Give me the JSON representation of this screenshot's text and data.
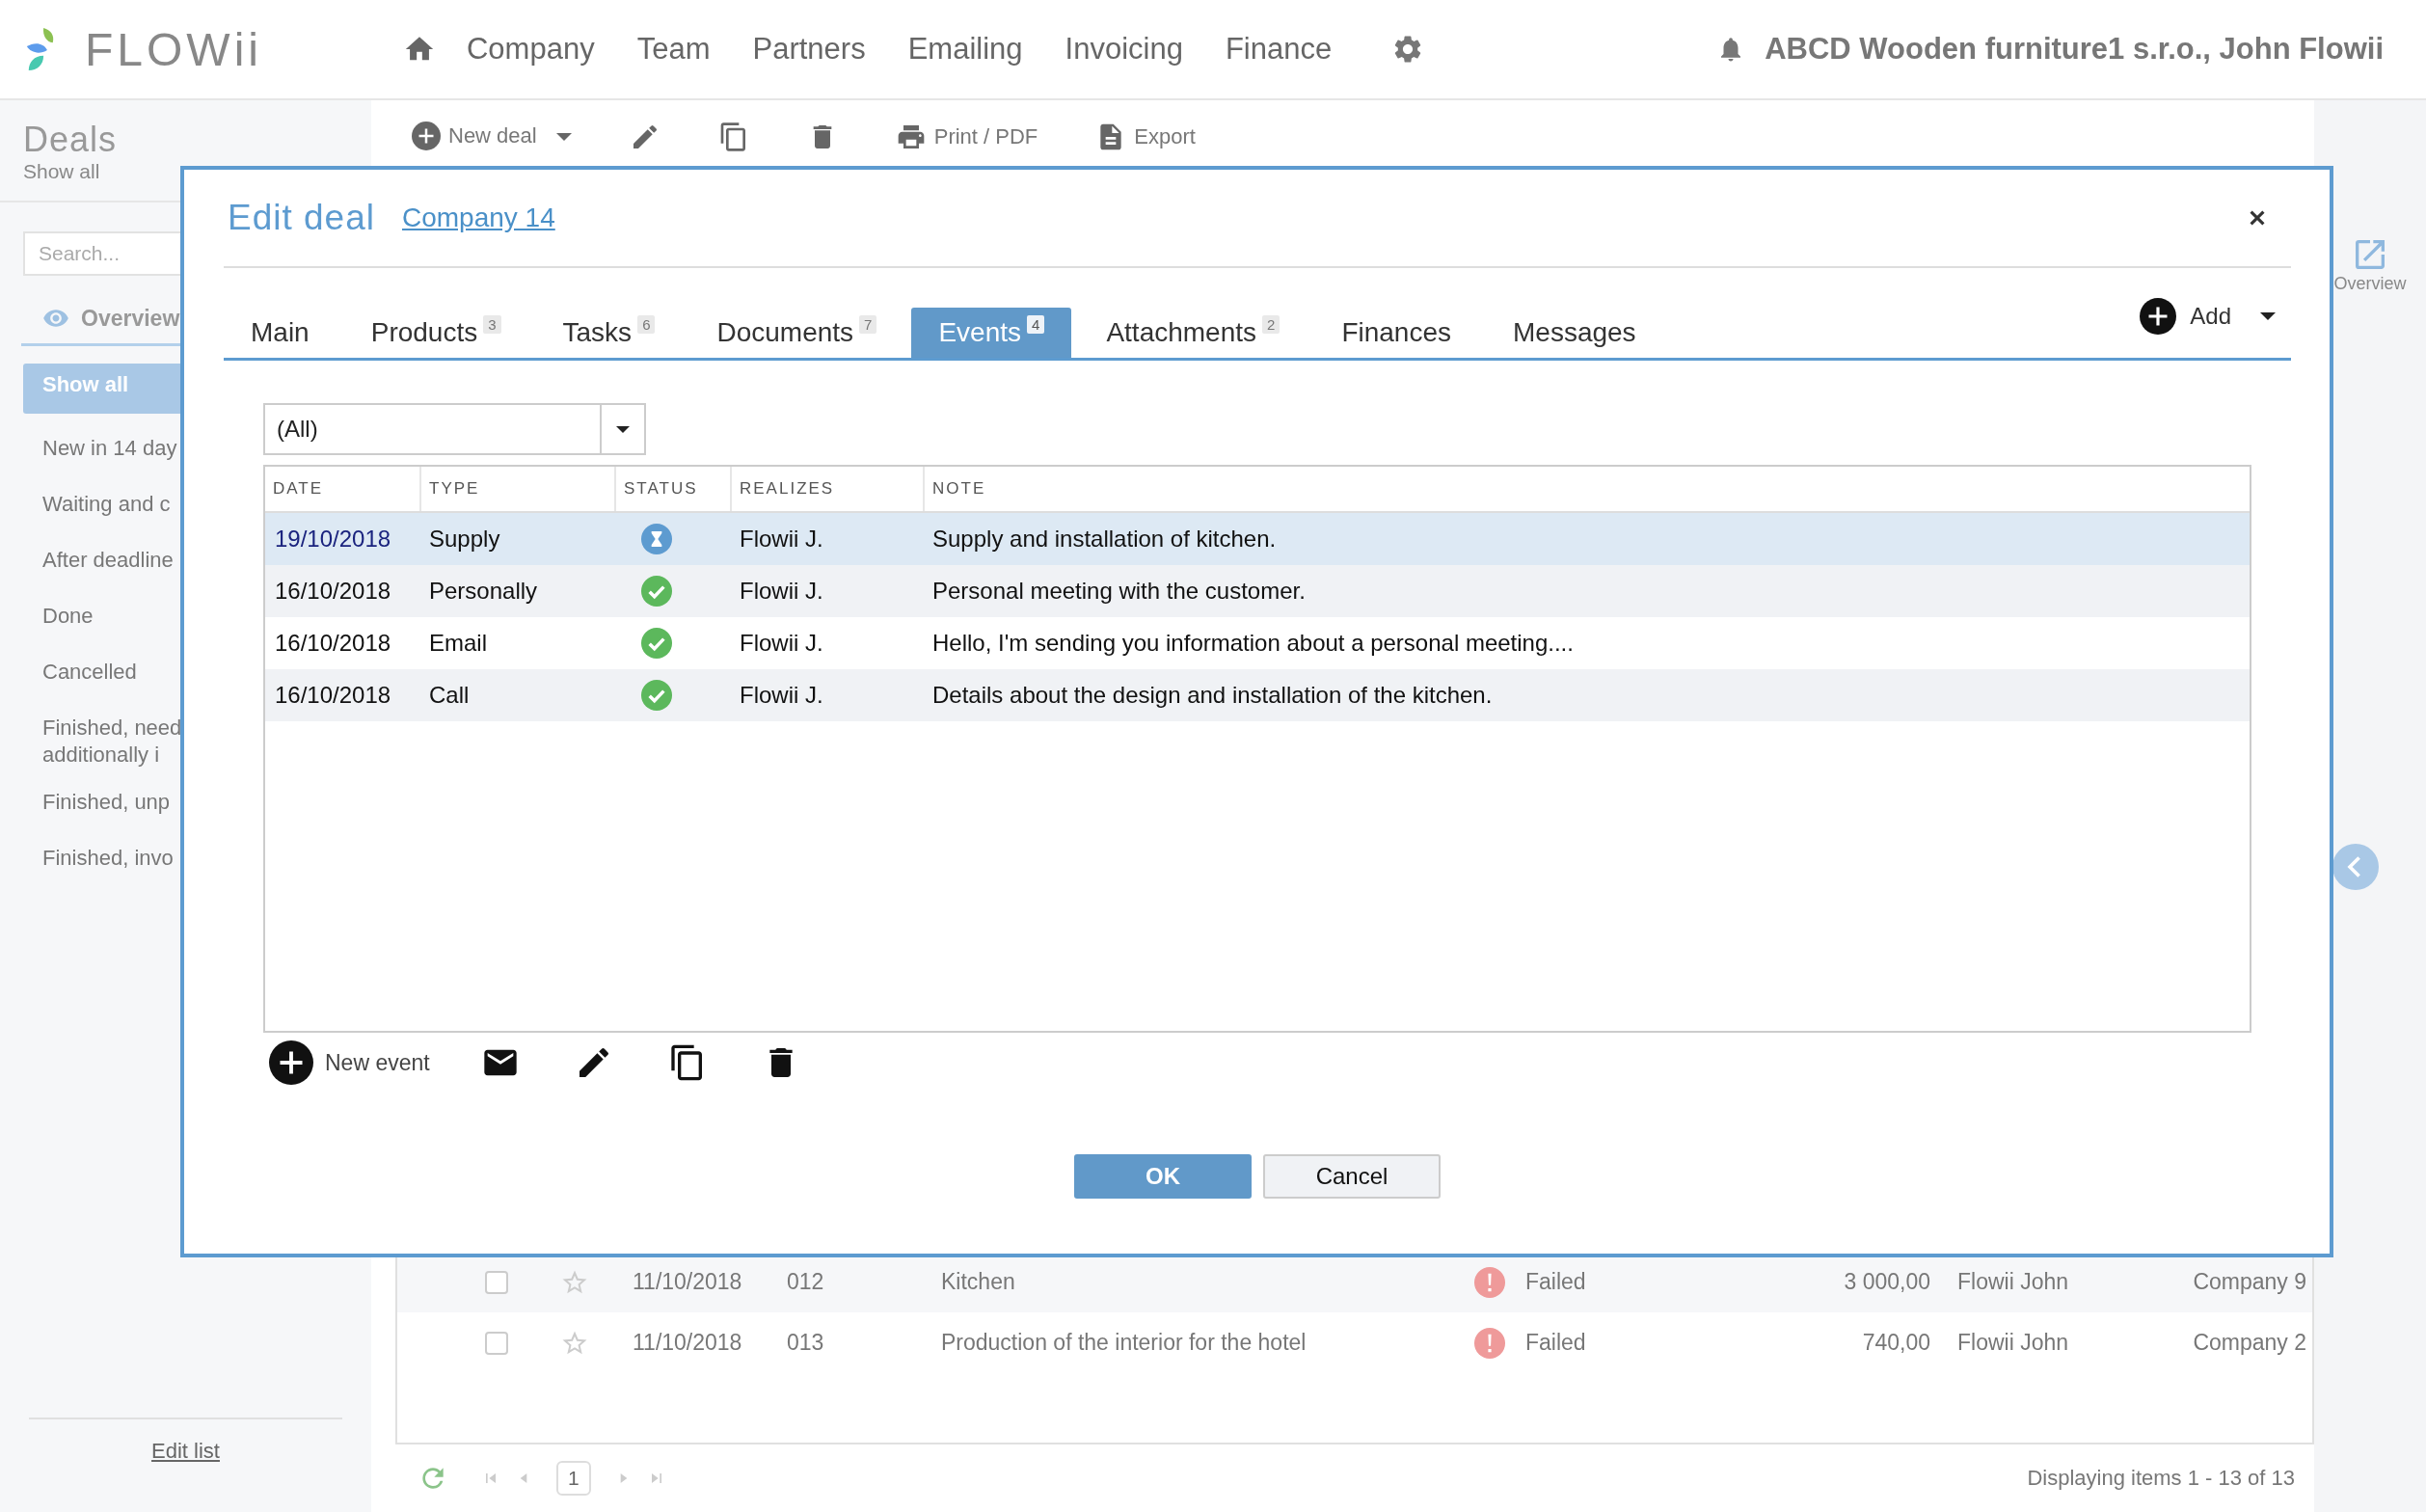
{
  "app": {
    "logo": "FLOWii",
    "nav": [
      "Company",
      "Team",
      "Partners",
      "Emailing",
      "Invoicing",
      "Finance"
    ],
    "user": "ABCD Wooden furniture1 s.r.o., John Flowii"
  },
  "sidebar": {
    "title": "Deals",
    "subtitle": "Show all",
    "search": {
      "placeholder": "Search..."
    },
    "tab": "Overview",
    "items": [
      {
        "label": "Show all",
        "selected": true
      },
      {
        "label": "New in 14 day",
        "selected": false
      },
      {
        "label": "Waiting and c",
        "selected": false
      },
      {
        "label": "After deadline",
        "selected": false
      },
      {
        "label": "Done",
        "selected": false
      },
      {
        "label": "Cancelled",
        "selected": false
      },
      {
        "label": "Finished, need\nadditionally i",
        "selected": false
      },
      {
        "label": "Finished, unp",
        "selected": false
      },
      {
        "label": "Finished, invo",
        "selected": false
      }
    ],
    "edit_list": "Edit list"
  },
  "toolbar": [
    {
      "kind": "add",
      "label": "New deal"
    },
    {
      "kind": "caret"
    },
    {
      "kind": "edit"
    },
    {
      "kind": "copy"
    },
    {
      "kind": "delete"
    },
    {
      "kind": "print",
      "label": "Print / PDF"
    },
    {
      "kind": "export",
      "label": "Export"
    }
  ],
  "right_panel": {
    "label": "Overview"
  },
  "deals_table": {
    "rows": [
      {
        "checked": false,
        "starred": false,
        "date": "11/10/2018",
        "number": "012",
        "name": "Kitchen",
        "kind": "failed",
        "status_label": "Failed",
        "amount": "3 000,00",
        "owner": "Flowii John",
        "company": "Company 9"
      },
      {
        "checked": false,
        "starred": false,
        "date": "11/10/2018",
        "number": "013",
        "name": "Production of the interior for the hotel",
        "kind": "failed",
        "status_label": "Failed",
        "amount": "740,00",
        "owner": "Flowii John",
        "company": "Company 2"
      }
    ]
  },
  "pager": {
    "page": "1",
    "summary": "Displaying items 1 - 13 of 13"
  },
  "dialog": {
    "title": "Edit deal",
    "link": "Company 14",
    "tabs": [
      {
        "label": "Main",
        "selected": false
      },
      {
        "label": "Products",
        "count": "3",
        "selected": false
      },
      {
        "label": "Tasks",
        "count": "6",
        "selected": false
      },
      {
        "label": "Documents",
        "count": "7",
        "selected": false
      },
      {
        "label": "Events",
        "count": "4",
        "selected": true
      },
      {
        "label": "Attachments",
        "count": "2",
        "selected": false
      },
      {
        "label": "Finances",
        "selected": false
      },
      {
        "label": "Messages",
        "selected": false
      }
    ],
    "add": "Add",
    "filter": {
      "value": "(All)"
    },
    "table": {
      "columns": [
        "DATE",
        "TYPE",
        "STATUS",
        "REALIZES",
        "NOTE"
      ],
      "rows": [
        {
          "date": "19/10/2018",
          "type": "Supply",
          "kind": "pending",
          "realizes": "Flowii J.",
          "note": "Supply and installation of kitchen.",
          "selected": true
        },
        {
          "date": "16/10/2018",
          "type": "Personally",
          "kind": "done",
          "realizes": "Flowii J.",
          "note": "Personal meeting with the customer.",
          "selected": false
        },
        {
          "date": "16/10/2018",
          "type": "Email",
          "kind": "done",
          "realizes": "Flowii J.",
          "note": "Hello, I'm sending you information about a personal meeting....",
          "selected": false
        },
        {
          "date": "16/10/2018",
          "type": "Call",
          "kind": "done",
          "realizes": "Flowii J.",
          "note": "Details about the design and installation of the kitchen.",
          "selected": false
        }
      ]
    },
    "actions": [
      {
        "kind": "add",
        "label": "New event"
      },
      {
        "kind": "mail"
      },
      {
        "kind": "edit"
      },
      {
        "kind": "copy"
      },
      {
        "kind": "delete"
      }
    ],
    "buttons": [
      {
        "kind": "primary",
        "label": "OK"
      },
      {
        "kind": "secondary",
        "label": "Cancel"
      }
    ]
  }
}
